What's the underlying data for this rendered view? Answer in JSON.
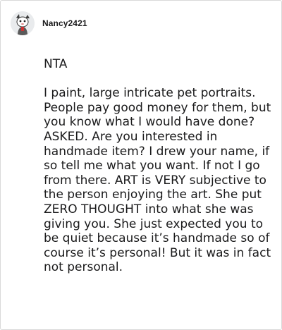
{
  "comment": {
    "author": "Nancy2421",
    "avatar_icon": "cartoon-avatar-icon",
    "paragraphs": [
      "NTA",
      "I paint, large intricate pet portraits. People pay good money for them, but you know what I would have done? ASKED. Are you interested in handmade item? I drew your name, if so tell me what you want. If not I go from there. ART is VERY subjective to the person enjoying the art. She put ZERO THOUGHT into what she was giving you. She just expected you to be quiet because it’s handmade so of course it’s personal! But it was in fact not personal."
    ]
  }
}
